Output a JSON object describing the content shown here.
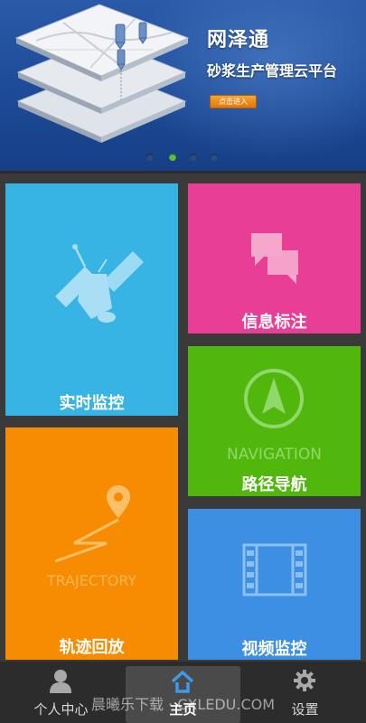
{
  "banner": {
    "title": "网泽通",
    "subtitle": "砂浆生产管理云平台",
    "enter_button": "点击进入",
    "dots": [
      false,
      true,
      false,
      false
    ]
  },
  "tiles": {
    "monitor": {
      "label": "实时监控",
      "icon": "satellite-icon"
    },
    "info": {
      "label": "信息标注",
      "icon": "chat-bubbles-icon"
    },
    "navigation": {
      "label": "路径导航",
      "watermark": "NAVIGATION",
      "icon": "compass-arrow-icon"
    },
    "trajectory": {
      "label": "轨迹回放",
      "watermark": "TRAJECTORY",
      "icon": "map-pin-route-icon"
    },
    "video": {
      "label": "视频监控",
      "icon": "film-strip-icon"
    }
  },
  "bottom_nav": {
    "items": [
      {
        "label": "个人中心",
        "icon": "user-icon",
        "active": false
      },
      {
        "label": "主页",
        "icon": "home-icon",
        "active": true
      },
      {
        "label": "设置",
        "icon": "gear-icon",
        "active": false
      }
    ]
  },
  "watermark_text": "晨曦乐下载 · CXLEDU.COM",
  "colors": {
    "banner_bg": "#1f4d9a",
    "monitor": "#37b4e4",
    "info": "#e93e96",
    "navigation": "#52b70c",
    "trajectory": "#f78c03",
    "video": "#3d8fe3",
    "bottom_bar": "#2c2c2c"
  }
}
